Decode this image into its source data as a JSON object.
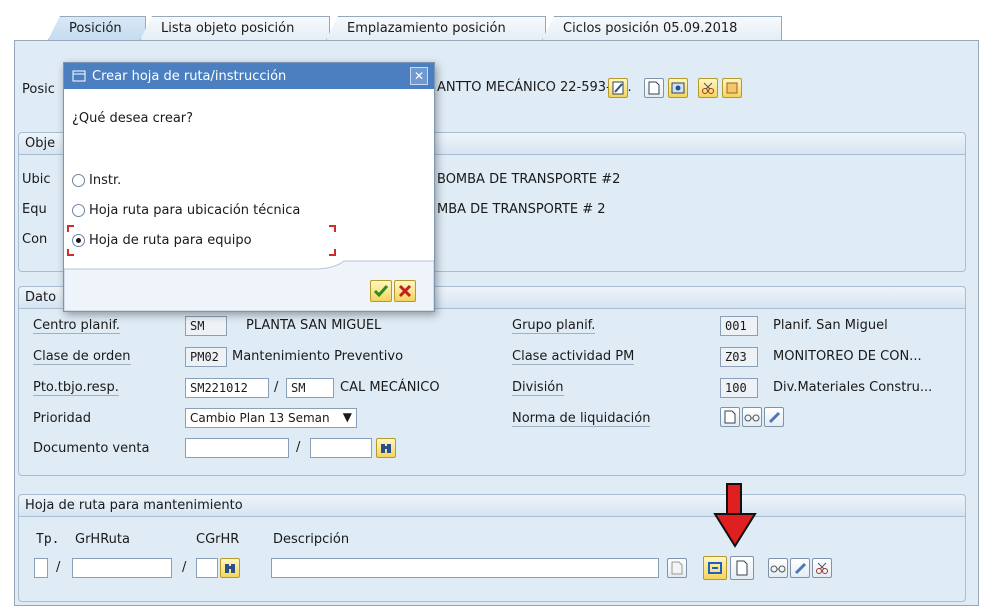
{
  "tabs": [
    "Posición",
    "Lista objeto posición",
    "Emplazamiento posición",
    "Ciclos posición 05.09.2018"
  ],
  "position": {
    "label": "Posic",
    "desc_value": "ANTTO MECÁNICO 22-593-B..."
  },
  "objeto_group": {
    "title": "Obje",
    "ubic_label": "Ubic",
    "ubic_desc": "BOMBA DE TRANSPORTE  #2",
    "equ_label": "Equ",
    "equ_desc": "MBA DE TRANSPORTE # 2",
    "con_label": "Con"
  },
  "datos_group": {
    "title": "Dato",
    "centro_label": "Centro planif.",
    "centro_value": "SM",
    "centro_desc": "PLANTA SAN MIGUEL",
    "clase_orden_label": "Clase de orden",
    "clase_orden_value": "PM02",
    "clase_orden_desc": "Mantenimiento Preventivo",
    "pto_label": "Pto.tbjo.resp.",
    "pto_value1": "SM221012",
    "pto_sep": "/",
    "pto_value2": "SM",
    "pto_desc": "CAL MECÁNICO",
    "prioridad_label": "Prioridad",
    "prioridad_value": "Cambio Plan 13 Seman",
    "doc_venta_label": "Documento venta",
    "doc_venta_sep": "/",
    "grupo_label": "Grupo planif.",
    "grupo_value": "001",
    "grupo_desc": "Planif. San Miguel",
    "clase_act_label": "Clase actividad PM",
    "clase_act_value": "Z03",
    "clase_act_desc": "MONITOREO DE CON...",
    "division_label": "División",
    "division_value": "100",
    "division_desc": "Div.Materiales Constru...",
    "norma_label": "Norma de liquidación"
  },
  "hoja_group": {
    "title": "Hoja de ruta para mantenimiento",
    "col_tp": "Tp.",
    "col_grh": "GrHRuta",
    "col_cgrh": "CGrHR",
    "col_desc": "Descripción",
    "sep1": "/",
    "sep2": "/"
  },
  "dialog": {
    "title": "Crear hoja de ruta/instrucción",
    "question": "¿Qué desea crear?",
    "options": [
      "Instr.",
      "Hoja ruta para ubicación técnica",
      "Hoja de ruta para equipo"
    ],
    "selected_index": 2
  },
  "colors": {
    "accent_arrow": "#e02020",
    "dialog_title_bg": "#4b7fc0"
  }
}
